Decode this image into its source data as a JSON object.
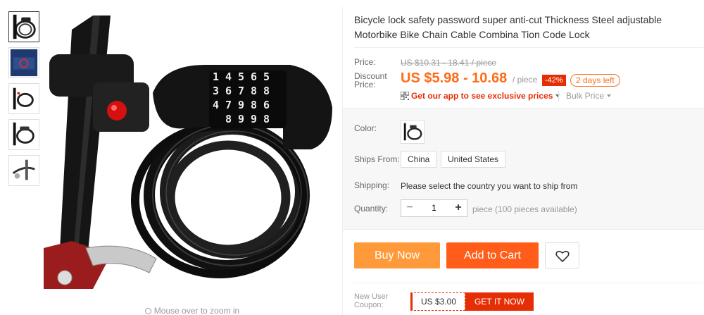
{
  "gallery": {
    "thumbnails": [
      "coiled cable lock",
      "boxed lock",
      "lock on bike",
      "lock closeup",
      "lock with bracket"
    ],
    "zoom_hint": "Mouse over to zoom in"
  },
  "product": {
    "title": "Bicycle lock safety password super anti-cut Thickness Steel adjustable Motorbike Bike Chain Cable Combina Tion Code Lock"
  },
  "price": {
    "price_label": "Price:",
    "original": "US $10.31 - 18.41 / piece",
    "discount_label": "Discount Price:",
    "discount": "US $5.98 - 10.68",
    "per_unit": "/ piece",
    "discount_pct": "-42%",
    "days_left": "2 days left",
    "app_promo": "Get our app to see exclusive prices",
    "bulk_price": "Bulk Price"
  },
  "options": {
    "color_label": "Color:",
    "ships_from_label": "Ships From:",
    "ships_from": [
      "China",
      "United States"
    ],
    "shipping_label": "Shipping:",
    "shipping_text": "Please select the country you want to ship from",
    "quantity_label": "Quantity:",
    "quantity": "1",
    "quantity_minus": "−",
    "quantity_plus": "+",
    "quantity_available": "piece (100 pieces available)"
  },
  "actions": {
    "buy_now": "Buy Now",
    "add_to_cart": "Add to Cart"
  },
  "coupon": {
    "label": "New User Coupon:",
    "amount": "US $3.00",
    "get_button": "GET IT NOW"
  },
  "colors": {
    "accent_orange": "#ff6b19",
    "buy_now": "#ff9a3b",
    "add_to_cart": "#ff5d19",
    "sale_red": "#e62e04"
  }
}
